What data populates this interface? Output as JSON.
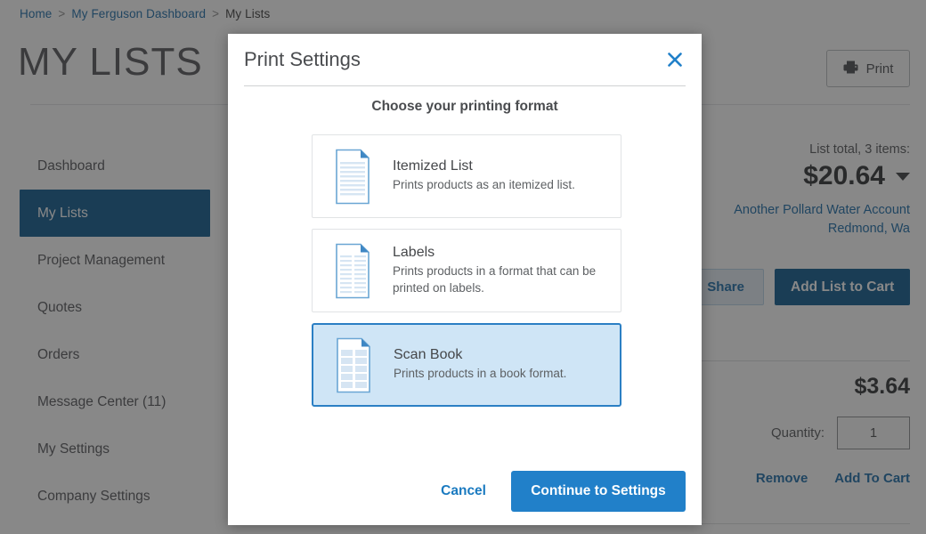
{
  "breadcrumb": {
    "items": [
      {
        "label": "Home",
        "link": true
      },
      {
        "label": "My Ferguson Dashboard",
        "link": true
      },
      {
        "label": "My Lists",
        "link": false
      }
    ],
    "separator": ">"
  },
  "page": {
    "title": "MY LISTS",
    "print_button": {
      "label": "Print",
      "icon": "printer-icon"
    }
  },
  "sidebar": {
    "items": [
      {
        "label": "Dashboard",
        "active": false
      },
      {
        "label": "My Lists",
        "active": true
      },
      {
        "label": "Project Management",
        "active": false
      },
      {
        "label": "Quotes",
        "active": false
      },
      {
        "label": "Orders",
        "active": false
      },
      {
        "label": "Message Center (11)",
        "active": false
      },
      {
        "label": "My Settings",
        "active": false
      },
      {
        "label": "Company Settings",
        "active": false
      }
    ]
  },
  "rail": {
    "total_label": "List total, 3 items:",
    "total_value": "$20.64",
    "caret_icon": "chevron-down-icon",
    "account_name": "Another Pollard Water Account",
    "account_location": "Redmond, Wa",
    "share_label": "Share",
    "add_list_label": "Add List to Cart"
  },
  "item": {
    "price": "$3.64",
    "quantity_label": "Quantity:",
    "quantity_value": "1",
    "remove_label": "Remove",
    "add_to_cart_label": "Add To Cart"
  },
  "modal": {
    "title": "Print Settings",
    "close_icon": "close-icon",
    "subtitle": "Choose your printing format",
    "options": [
      {
        "name": "Itemized List",
        "description": "Prints products as an itemized list.",
        "icon": "itemized-list-icon",
        "selected": false
      },
      {
        "name": "Labels",
        "description": "Prints products in a format that can be printed on labels.",
        "icon": "labels-icon",
        "selected": false
      },
      {
        "name": "Scan Book",
        "description": "Prints products in a book format.",
        "icon": "scan-book-icon",
        "selected": true
      }
    ],
    "cancel_label": "Cancel",
    "continue_label": "Continue to Settings"
  },
  "colors": {
    "brand_dark_blue": "#0d5a8e",
    "link_blue": "#1a6ba8",
    "primary_button_blue": "#2180c9",
    "selected_card_bg": "#cfe5f6",
    "selected_card_border": "#2b7fc4",
    "overlay": "rgba(38,38,38,0.55)"
  }
}
